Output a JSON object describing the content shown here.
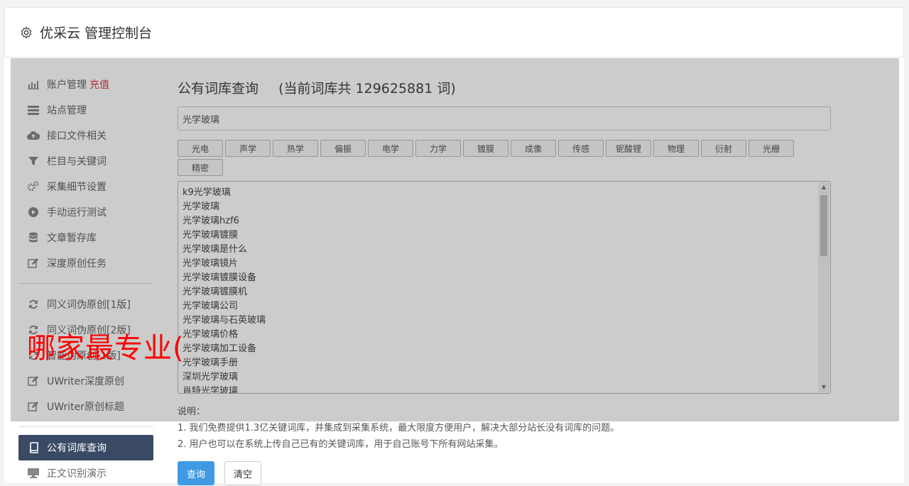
{
  "header": {
    "title": "优采云 管理控制台",
    "icon": "gear-icon"
  },
  "sidebar": {
    "items": [
      {
        "label": "账户管理",
        "badge": "充值",
        "icon": "bar-chart-icon"
      },
      {
        "label": "站点管理",
        "icon": "list-icon"
      },
      {
        "label": "接口文件相关",
        "icon": "cloud-upload-icon"
      },
      {
        "label": "栏目与关键词",
        "icon": "filter-icon"
      },
      {
        "label": "采集细节设置",
        "icon": "cogs-icon"
      },
      {
        "label": "手动运行测试",
        "icon": "play-icon"
      },
      {
        "label": "文章暂存库",
        "icon": "database-icon"
      },
      {
        "label": "深度原创任务",
        "icon": "edit-icon"
      }
    ],
    "items2": [
      {
        "label": "同义词伪原创[1版]",
        "icon": "refresh-icon"
      },
      {
        "label": "同义词伪原创[2版]",
        "icon": "refresh-icon"
      },
      {
        "label": "智能伪原创[1版]",
        "icon": "refresh-icon"
      },
      {
        "label": "UWriter深度原创",
        "icon": "edit-icon"
      },
      {
        "label": "UWriter原创标题",
        "icon": "edit-icon"
      }
    ],
    "items3": [
      {
        "label": "公有词库查询",
        "icon": "book-icon",
        "active": true
      },
      {
        "label": "正文识别演示",
        "icon": "monitor-icon"
      }
    ]
  },
  "main": {
    "title": "公有词库查询",
    "count_text": "(当前词库共 129625881 词)",
    "search_value": "光学玻璃",
    "tags": [
      "光电",
      "声学",
      "热学",
      "偏振",
      "电学",
      "力学",
      "镀膜",
      "成像",
      "传感",
      "铌酸锂",
      "物理",
      "衍射",
      "光栅",
      "精密"
    ],
    "results": [
      "k9光学玻璃",
      "光学玻璃",
      "光学玻璃hzf6",
      "光学玻璃镀膜",
      "光学玻璃是什么",
      "光学玻璃镜片",
      "光学玻璃镀膜设备",
      "光学玻璃镀膜机",
      "光学玻璃公司",
      "光学玻璃与石英玻璃",
      "光学玻璃价格",
      "光学玻璃加工设备",
      "光学玻璃手册",
      "深圳光学玻璃",
      "肖特光学玻璃"
    ],
    "desc_title": "说明：",
    "desc_1": "1. 我们免费提供1.3亿关键词库，并集成到采集系统，最大限度方便用户，解决大部分站长没有词库的问题。",
    "desc_2": "2. 用户也可以在系统上传自己已有的关键词库，用于自己账号下所有网站采集。",
    "query_label": "查询",
    "clear_label": "清空"
  },
  "overlay_text": "哪家最专业(",
  "colors": {
    "accent": "#3f9ae3",
    "active_nav": "#3a4a64",
    "badge": "#e4393c",
    "overlay_text": "#ff0000"
  }
}
